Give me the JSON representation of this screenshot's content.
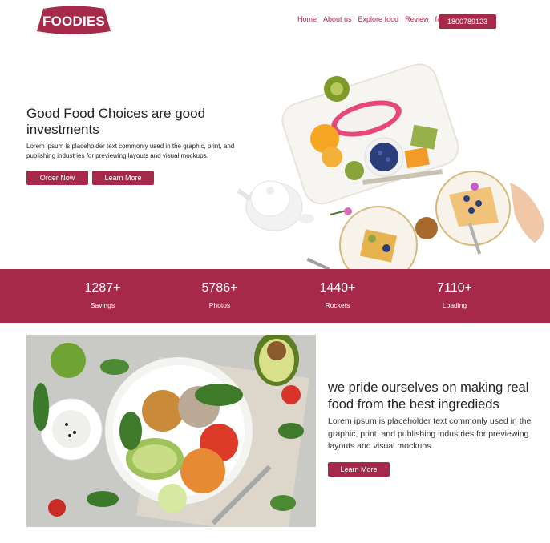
{
  "brand": {
    "logo_text": "FOODIES",
    "accent": "#a7294a"
  },
  "nav": {
    "items": [
      "Home",
      "About us",
      "Explore food",
      "Review",
      "faq"
    ],
    "phone": "1800789123"
  },
  "hero": {
    "title": "Good Food Choices are good investments",
    "text": "Lorem ipsum is placeholder text commonly used in the graphic, print, and publishing industries for previewing layouts and visual mockups.",
    "order_label": "Order Now",
    "learn_label": "Learn More"
  },
  "stats": [
    {
      "value": "1287+",
      "label": "Savings"
    },
    {
      "value": "5786+",
      "label": "Photos"
    },
    {
      "value": "1440+",
      "label": "Rockets"
    },
    {
      "value": "7110+",
      "label": "Loading"
    }
  ],
  "about": {
    "title": "we pride ourselves on making real food from the best ingredieds",
    "text": "Lorem ipsum is placeholder text commonly used in the graphic, print, and publishing industries for previewing layouts and visual mockups.",
    "learn_label": "Learn More"
  }
}
